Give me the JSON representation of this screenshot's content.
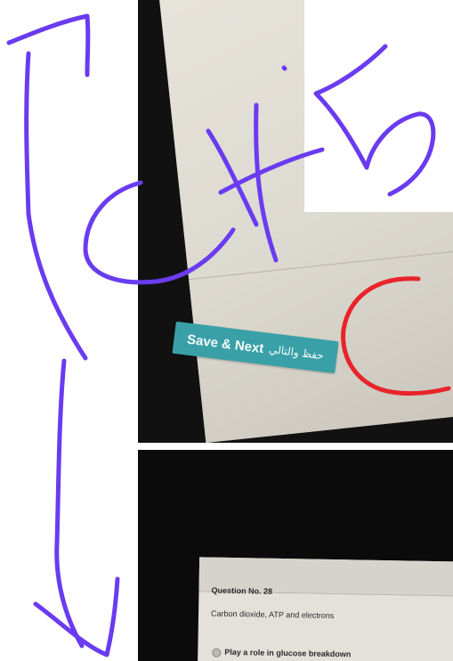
{
  "top_screen": {
    "save_next_label": "Save & Next",
    "save_next_arabic": "حفظ والتالي"
  },
  "bottom_screen": {
    "question_number": "Question No. 28",
    "question_text": "Carbon dioxide, ATP and electrons",
    "option_label": "Play a role in glucose breakdown"
  },
  "annotation": {
    "pen_color": "#6a3bf0",
    "marker_color": "#e8242a"
  }
}
